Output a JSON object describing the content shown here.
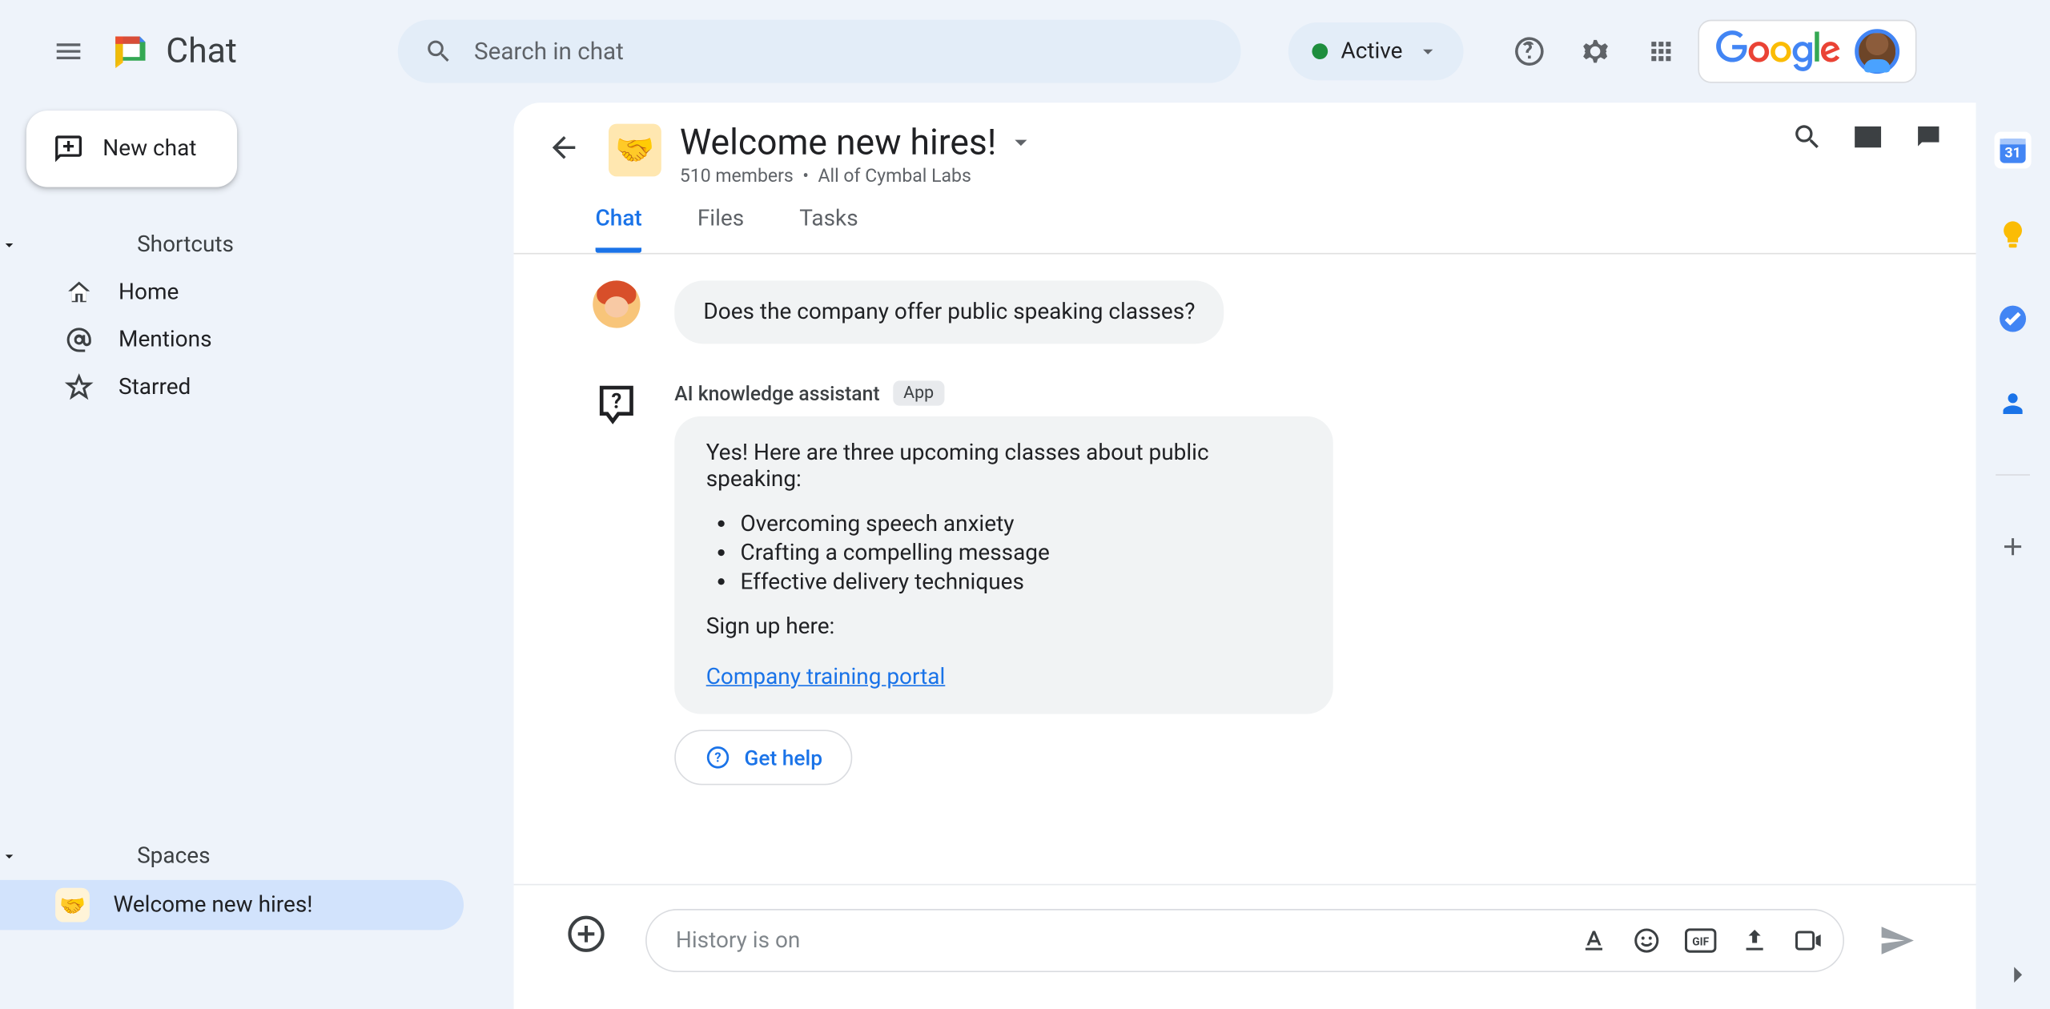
{
  "app": {
    "name": "Chat"
  },
  "search": {
    "placeholder": "Search in chat"
  },
  "status": {
    "label": "Active"
  },
  "brand": {
    "word": "Google"
  },
  "newChat": {
    "label": "New chat"
  },
  "sidebar": {
    "shortcuts": {
      "header": "Shortcuts",
      "items": [
        {
          "label": "Home"
        },
        {
          "label": "Mentions"
        },
        {
          "label": "Starred"
        }
      ]
    },
    "spaces": {
      "header": "Spaces",
      "items": [
        {
          "label": "Welcome new hires!",
          "emoji": "🤝"
        }
      ]
    }
  },
  "conversation": {
    "title": "Welcome new hires!",
    "members": "510 members",
    "scope": "All of Cymbal Labs",
    "emoji": "🤝",
    "tabs": {
      "chat": "Chat",
      "files": "Files",
      "tasks": "Tasks"
    },
    "userMessage": "Does the company offer public speaking classes?",
    "bot": {
      "name": "AI knowledge assistant",
      "chip": "App",
      "intro": "Yes! Here are three upcoming classes about public speaking:",
      "items": [
        "Overcoming speech anxiety",
        "Crafting a compelling message",
        "Effective delivery techniques"
      ],
      "signup": "Sign up here:",
      "linkText": "Company training portal",
      "helpLabel": "Get help"
    }
  },
  "composer": {
    "placeholder": "History is on"
  }
}
